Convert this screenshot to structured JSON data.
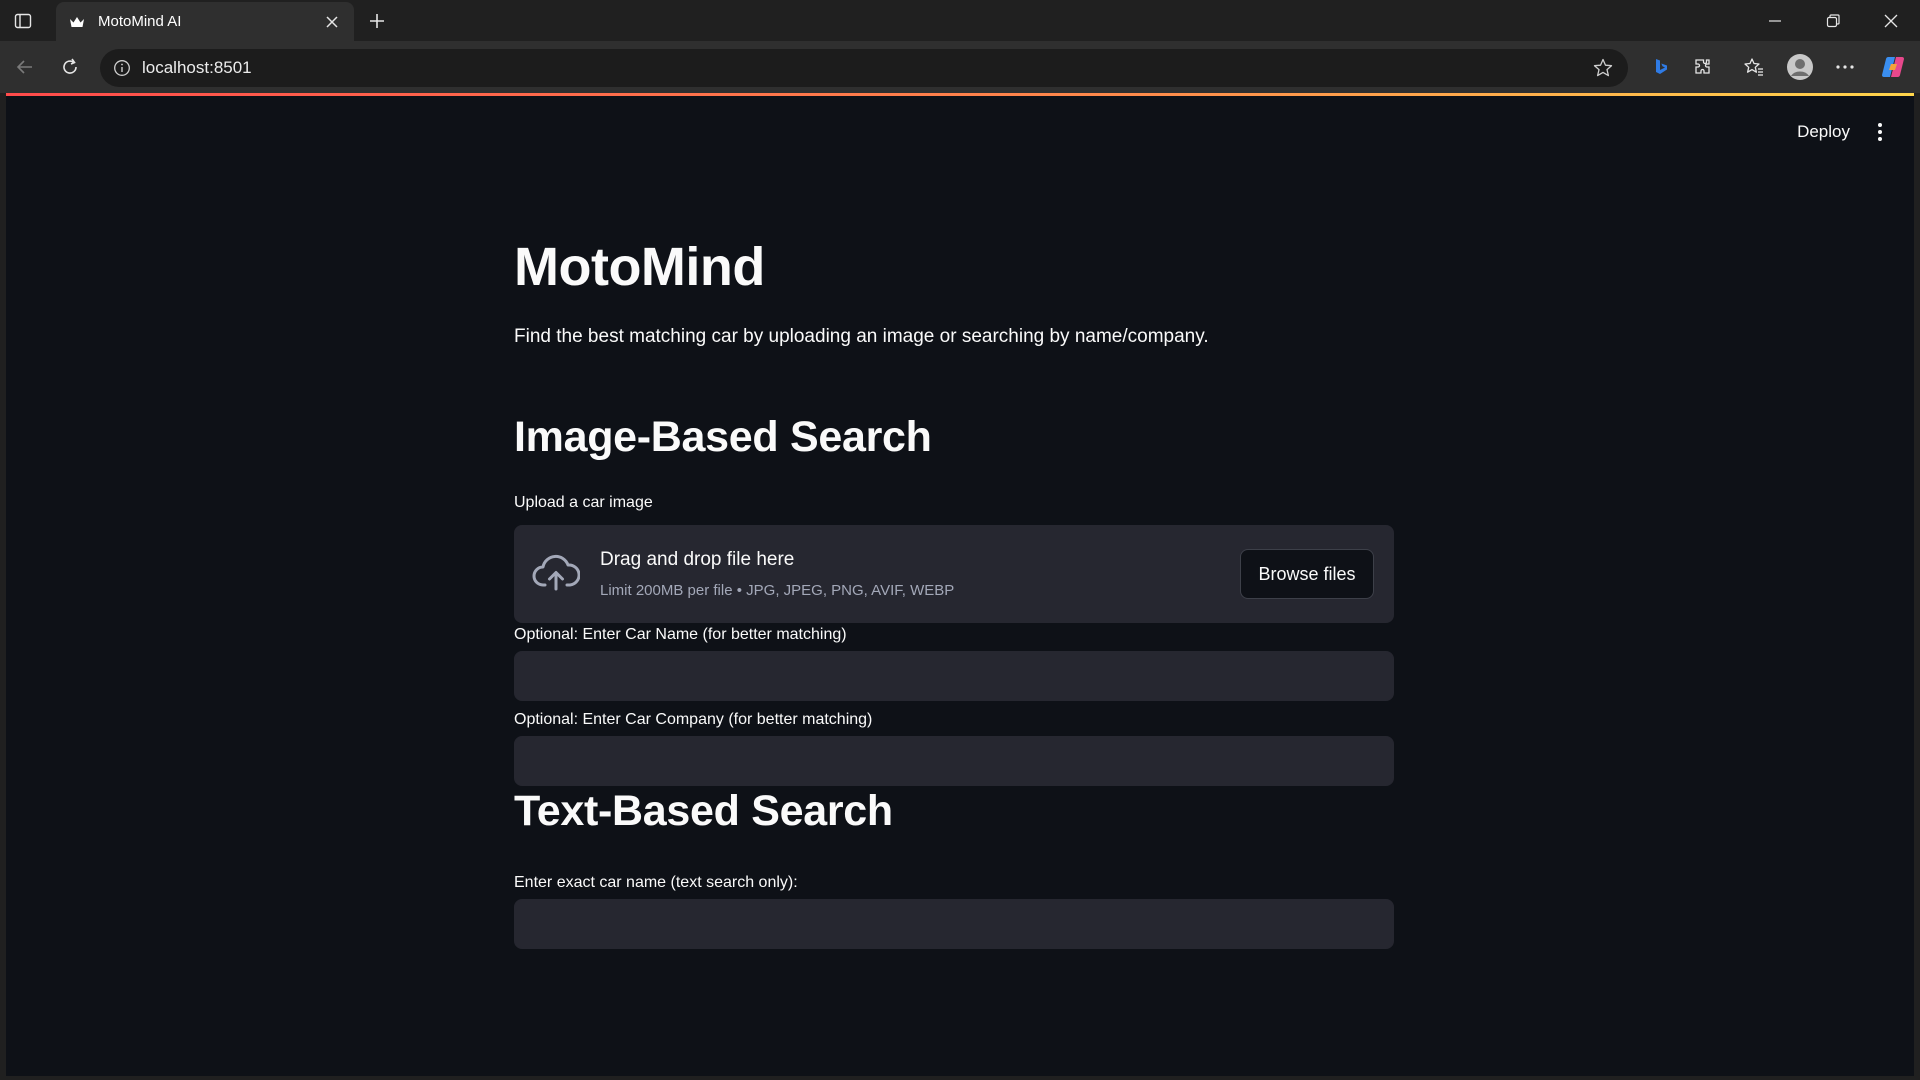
{
  "browser": {
    "tab_title": "MotoMind AI",
    "url": "localhost:8501"
  },
  "app": {
    "deploy_label": "Deploy",
    "title": "MotoMind",
    "subtitle": "Find the best matching car by uploading an image or searching by name/company.",
    "image_section": {
      "heading": "Image-Based Search",
      "upload_label": "Upload a car image",
      "dropzone_title": "Drag and drop file here",
      "dropzone_limit": "Limit 200MB per file • JPG, JPEG, PNG, AVIF, WEBP",
      "browse_label": "Browse files",
      "car_name_label": "Optional: Enter Car Name (for better matching)",
      "car_name_value": "",
      "car_company_label": "Optional: Enter Car Company (for better matching)",
      "car_company_value": ""
    },
    "text_section": {
      "heading": "Text-Based Search",
      "exact_name_label": "Enter exact car name (text search only):",
      "exact_name_value": ""
    }
  },
  "colors": {
    "app_background": "#0e1117",
    "widget_background": "#262730",
    "text": "#fafafa",
    "muted_text": "#a3a8b8",
    "accent": "#ff4b4b"
  },
  "icons": [
    "sidebar-toggle-icon",
    "favicon-crown-icon",
    "close-icon",
    "plus-icon",
    "minimize-icon",
    "restore-icon",
    "window-close-icon",
    "back-arrow-icon",
    "reload-icon",
    "info-icon",
    "star-icon",
    "bing-icon",
    "extensions-icon",
    "favorites-icon",
    "profile-icon",
    "more-icon",
    "copilot-icon",
    "kebab-menu-icon",
    "upload-cloud-icon"
  ]
}
